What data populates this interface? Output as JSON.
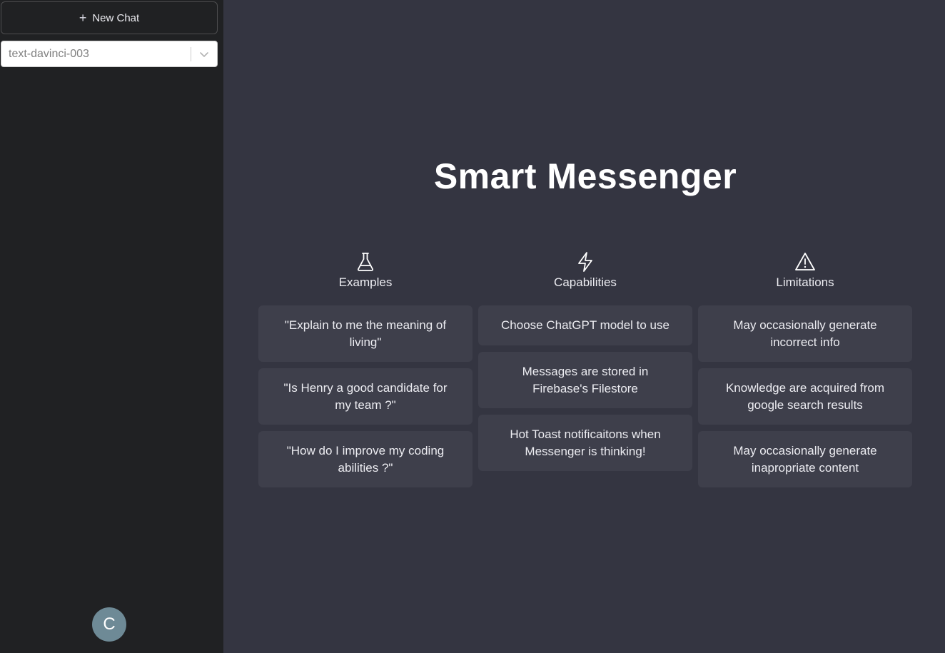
{
  "sidebar": {
    "new_chat_label": "New Chat",
    "model": "text-davinci-003",
    "avatar_letter": "C"
  },
  "main": {
    "title": "Smart Messenger",
    "columns": {
      "examples": {
        "label": "Examples",
        "icon": "flask-icon",
        "items": [
          "\"Explain to me the meaning of living\"",
          "\"Is Henry a good candidate for my team ?\"",
          "\"How do I improve my coding abilities ?\""
        ]
      },
      "capabilities": {
        "label": "Capabilities",
        "icon": "lightning-icon",
        "items": [
          "Choose ChatGPT model to use",
          "Messages are stored in Firebase's Filestore",
          "Hot Toast notificaitons when Messenger is thinking!"
        ]
      },
      "limitations": {
        "label": "Limitations",
        "icon": "warning-icon",
        "items": [
          "May occasionally generate incorrect info",
          "Knowledge are acquired from google search results",
          "May occasionally generate inapropriate content"
        ]
      }
    }
  },
  "colors": {
    "sidebar_bg": "#202123",
    "main_bg": "#343541",
    "card_bg": "#3e3f4b",
    "avatar_bg": "#6e8a96"
  }
}
